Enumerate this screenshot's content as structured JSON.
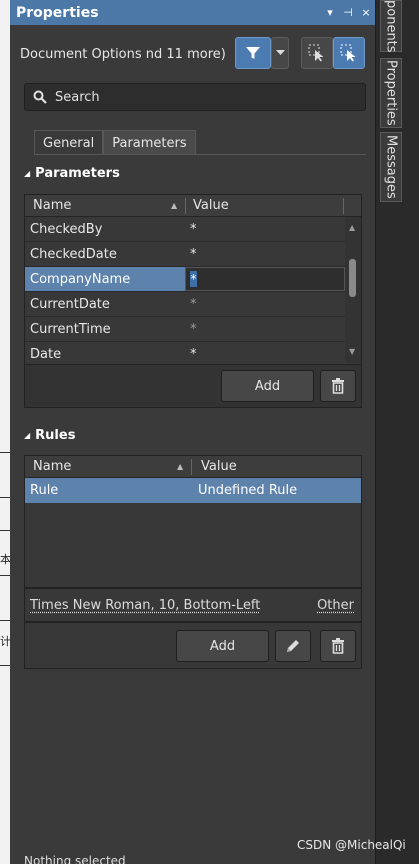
{
  "panel": {
    "title": "Properties"
  },
  "titlebar": {
    "menu_glyph": "▾",
    "pin_glyph": "⊣",
    "close_glyph": "×"
  },
  "filter": {
    "label": "Document Options",
    "suffix": "nd 11 more)"
  },
  "search": {
    "placeholder": "Search"
  },
  "tabs": [
    {
      "label": "General"
    },
    {
      "label": "Parameters"
    }
  ],
  "parameters": {
    "heading": "Parameters",
    "col_name": "Name",
    "col_value": "Value",
    "rows": [
      {
        "name": "CheckedBy",
        "value": "*"
      },
      {
        "name": "CheckedDate",
        "value": "*"
      },
      {
        "name": "CompanyName",
        "value": "*"
      },
      {
        "name": "CurrentDate",
        "value": "*"
      },
      {
        "name": "CurrentTime",
        "value": "*"
      },
      {
        "name": "Date",
        "value": "*"
      }
    ],
    "add_label": "Add"
  },
  "rules": {
    "heading": "Rules",
    "col_name": "Name",
    "col_value": "Value",
    "rows": [
      {
        "name": "Rule",
        "value": "Undefined Rule"
      }
    ],
    "font_desc": "Times New Roman, 10, Bottom-Left",
    "other_label": "Other",
    "add_label": "Add"
  },
  "right_rail": {
    "tabs": [
      "ponents",
      "Properties",
      "Messages"
    ]
  },
  "status": {
    "text": "Nothing selected"
  },
  "left_strip": {
    "glyphs": [
      "本",
      "计"
    ]
  },
  "watermark": "CSDN @MichealQi",
  "colors": {
    "accent": "#4c78a8",
    "selection": "#5d82ab"
  }
}
